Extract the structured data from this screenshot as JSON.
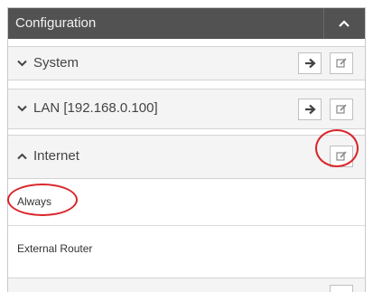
{
  "header": {
    "title": "Configuration"
  },
  "rows": {
    "system": {
      "label": "System"
    },
    "lan": {
      "label": "LAN [192.168.0.100]"
    },
    "internet": {
      "label": "Internet"
    }
  },
  "internet_options": [
    "Always",
    "External Router"
  ],
  "icons": {
    "collapse": "chevron-up-icon",
    "expand": "chevron-down-icon",
    "go": "arrow-right-icon",
    "edit": "edit-icon"
  },
  "colors": {
    "header_bg": "#525252",
    "row_bg": "#f4f4f4",
    "highlight_ring": "#d9252a"
  }
}
